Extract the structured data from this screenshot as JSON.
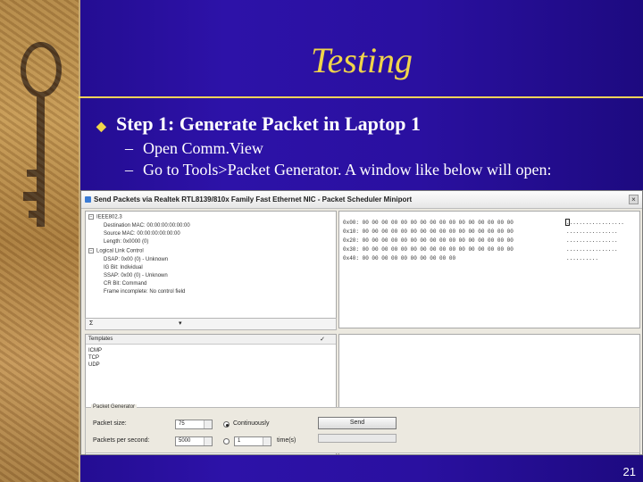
{
  "slide": {
    "title": "Testing",
    "main_bullet": "Step 1: Generate Packet in Laptop 1",
    "sub_bullets": [
      "Open Comm.View",
      "Go to Tools>Packet Generator. A window like below will open:"
    ],
    "page_number": "21",
    "accent_color": "#f0d54a",
    "background_color": "#2a10a0"
  },
  "window": {
    "title": "Send Packets via  Realtek RTL8139/810x Family Fast Ethernet NIC - Packet Scheduler Miniport",
    "tree": [
      {
        "text": "IEEE802.3",
        "level": 0,
        "expander": "−"
      },
      {
        "text": "Destination MAC: 00:00:00:00:00:00",
        "level": 1
      },
      {
        "text": "Source MAC: 00:00:00:00:00:00",
        "level": 1
      },
      {
        "text": "Length: 0x0000 (0)",
        "level": 1
      },
      {
        "text": "Logical Link Control",
        "level": 0,
        "expander": "−"
      },
      {
        "text": "DSAP: 0x00 (0) - Unknown",
        "level": 1
      },
      {
        "text": "IG Bit: Individual",
        "level": 1
      },
      {
        "text": "SSAP: 0x00 (0) - Unknown",
        "level": 1
      },
      {
        "text": "CR Bit: Command",
        "level": 1
      },
      {
        "text": "Frame incomplete: No control field",
        "level": 1
      }
    ],
    "hex_rows": [
      {
        "offset": "0x00:",
        "bytes": "00 00 00 00 00 00 00 00 00 00 00 00 00 00 00 00",
        "ascii": ".................."
      },
      {
        "offset": "0x10:",
        "bytes": "00 00 00 00 00 00 00 00 00 00 00 00 00 00 00 00",
        "ascii": "................"
      },
      {
        "offset": "0x20:",
        "bytes": "00 00 00 00 00 00 00 00 00 00 00 00 00 00 00 00",
        "ascii": "................"
      },
      {
        "offset": "0x30:",
        "bytes": "00 00 00 00 00 00 00 00 00 00 00 00 00 00 00 00",
        "ascii": "................"
      },
      {
        "offset": "0x40:",
        "bytes": "00 00 00 00 00 00 00 00 00 00",
        "ascii": ".........."
      }
    ],
    "sigma_label": "Σ",
    "templates": {
      "header": "Templates",
      "items": [
        "ICMP",
        "TCP",
        "UDP"
      ]
    },
    "generator": {
      "legend": "Packet Generator",
      "packet_size_label": "Packet size:",
      "packet_size_value": "75",
      "pps_label": "Packets per second:",
      "pps_value": "5000",
      "continuously_label": "Continuously",
      "times_value": "1",
      "times_label": "time(s)",
      "send_label": "Send"
    }
  }
}
